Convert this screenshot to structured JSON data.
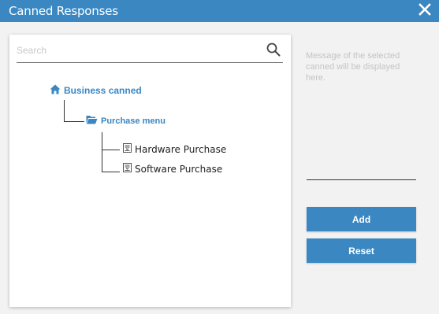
{
  "dialog": {
    "title": "Canned Responses",
    "accent_color": "#3a87c2"
  },
  "search": {
    "placeholder": "Search",
    "value": ""
  },
  "tree": {
    "root": {
      "label": "Business canned",
      "icon": "home-icon"
    },
    "folder": {
      "label": "Purchase menu",
      "icon": "folder-open-icon"
    },
    "items": [
      {
        "label": "Hardware Purchase",
        "icon": "document-icon"
      },
      {
        "label": "Software Purchase",
        "icon": "document-icon"
      }
    ]
  },
  "preview": {
    "placeholder": "Message of the selected canned will be displayed here."
  },
  "buttons": {
    "add_label": "Add",
    "reset_label": "Reset"
  }
}
